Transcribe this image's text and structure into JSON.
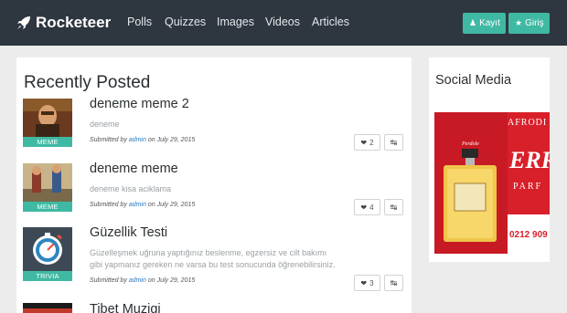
{
  "app": {
    "brand": "Rocketeer"
  },
  "nav": {
    "links": [
      "Polls",
      "Quizzes",
      "Images",
      "Videos",
      "Articles"
    ],
    "register_label": "Kayıt",
    "login_label": "Giriş"
  },
  "main": {
    "title": "Recently Posted",
    "posts": [
      {
        "title": "deneme meme 2",
        "description": "deneme",
        "category": "MEME",
        "submitted_prefix": "Submitted by",
        "author": "admin",
        "date_prefix": "on",
        "date": "July 29, 2015",
        "likes": "2"
      },
      {
        "title": "deneme meme",
        "description": "deneme kisa aciklama",
        "category": "MEME",
        "submitted_prefix": "Submitted by",
        "author": "admin",
        "date_prefix": "on",
        "date": "July 29, 2015",
        "likes": "4"
      },
      {
        "title": "Güzellik Testi",
        "description": "Güzelleşmek uğruna yaptığınız beslenme, egzersiz ve cilt bakımı gibi yapmanız gereken ne varsa bu test sonucunda öğrenebilirsiniz.",
        "category": "TRIVIA",
        "submitted_prefix": "Submitted by",
        "author": "admin",
        "date_prefix": "on",
        "date": "July 29, 2015",
        "likes": "3"
      },
      {
        "title": "Tibet Muzigi"
      }
    ]
  },
  "sidebar": {
    "title": "Social Media",
    "ad": {
      "line1": "AFRODI",
      "line2": "ERR",
      "line3": "PARF",
      "bottle": "Perdole",
      "phone": "0212 909"
    }
  },
  "colors": {
    "navbar": "#2e373f",
    "accent": "#3fb9a3",
    "link": "#2a7bc0",
    "ad_red": "#d8202a"
  }
}
